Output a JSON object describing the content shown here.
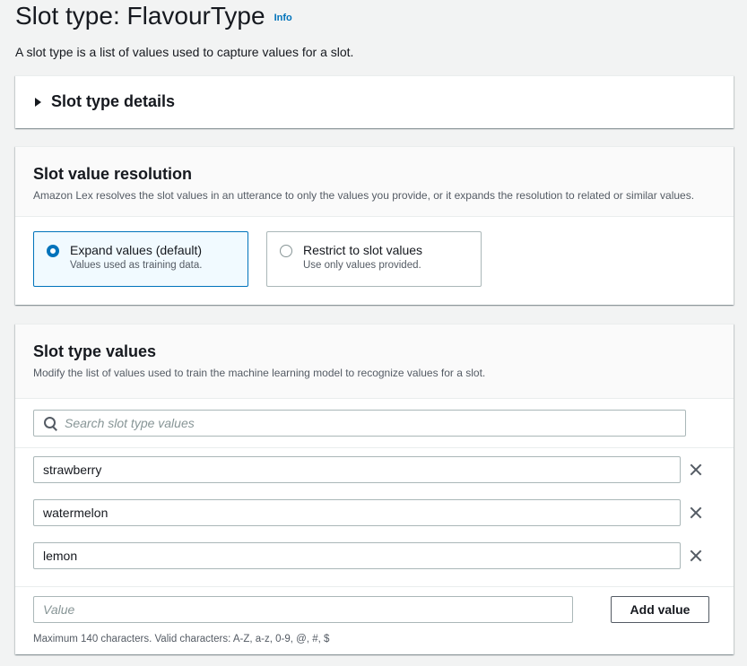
{
  "header": {
    "title": "Slot type: FlavourType",
    "info_label": "Info",
    "description": "A slot type is a list of values used to capture values for a slot."
  },
  "details": {
    "label": "Slot type details",
    "expanded": false
  },
  "resolution": {
    "title": "Slot value resolution",
    "subtitle": "Amazon Lex resolves the slot values in an utterance to only the values you provide, or it expands the resolution to related or similar values.",
    "options": [
      {
        "title": "Expand values (default)",
        "description": "Values used as training data.",
        "selected": true
      },
      {
        "title": "Restrict to slot values",
        "description": "Use only values provided.",
        "selected": false
      }
    ]
  },
  "values_section": {
    "title": "Slot type values",
    "subtitle": "Modify the list of values used to train the machine learning model to recognize values for a slot.",
    "search_placeholder": "Search slot type values",
    "values": [
      "strawberry",
      "watermelon",
      "lemon"
    ],
    "new_value_placeholder": "Value",
    "add_button_label": "Add value",
    "constraint": "Maximum 140 characters. Valid characters: A-Z, a-z, 0-9, @, #, $"
  },
  "colors": {
    "accent": "#0073bb",
    "selected_bg": "#f1faff",
    "page_bg": "#f2f3f3"
  }
}
